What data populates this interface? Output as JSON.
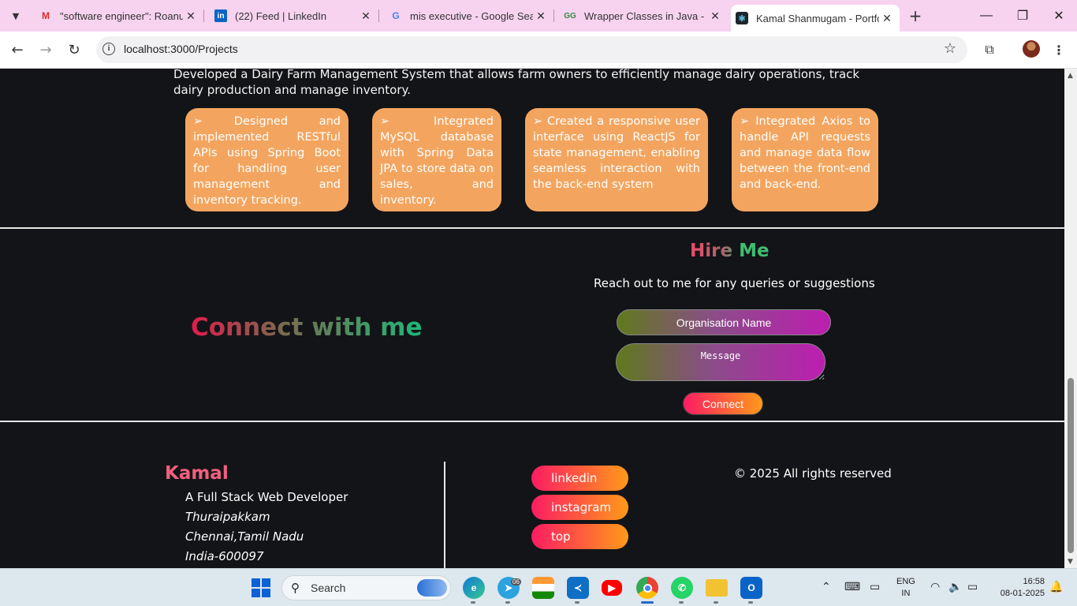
{
  "browser": {
    "tabs": [
      {
        "title": "\"software engineer\": Roanuz",
        "icon": "gmail-icon"
      },
      {
        "title": "(22) Feed | LinkedIn",
        "icon": "linkedin-icon"
      },
      {
        "title": "mis executive - Google Search",
        "icon": "google-icon"
      },
      {
        "title": "Wrapper Classes in Java - Ge",
        "icon": "geeksforgeeks-icon"
      },
      {
        "title": "Kamal Shanmugam - Portfolio",
        "icon": "react-icon",
        "active": true
      }
    ],
    "url": "localhost:3000/Projects"
  },
  "project": {
    "description": "Developed a Dairy Farm Management System that allows farm owners to efficiently manage dairy operations, track dairy production and manage inventory.",
    "cards": [
      "➢ Designed and implemented RESTful APIs using Spring Boot for handling user management and inventory tracking.",
      "➢ Integrated MySQL database with Spring Data JPA to store data on sales, and inventory.",
      "➢ Created a responsive user interface using ReactJS for state management, enabling seamless interaction with the back-end system",
      "➢ Integrated Axios to handle API requests and manage data flow between the front-end and back-end."
    ]
  },
  "contact": {
    "connect_heading": "Connect with me",
    "hire_heading": "Hire Me",
    "subtitle": "Reach out to me for any queries or suggestions",
    "org_placeholder": "Organisation Name",
    "message_placeholder": "Message",
    "submit_label": "Connect"
  },
  "footer": {
    "name": "Kamal",
    "role": "A Full Stack Web Developer",
    "address": [
      "Thuraipakkam",
      "Chennai,Tamil Nadu",
      "India-600097"
    ],
    "links": [
      "linkedin",
      "instagram",
      "top"
    ],
    "copyright": "© 2025 All rights reserved"
  },
  "taskbar": {
    "search_label": "Search",
    "telegram_badge": "06",
    "language": [
      "ENG",
      "IN"
    ],
    "time": "16:58",
    "date": "08-01-2025"
  },
  "colors": {
    "card_orange": "#f3a55f",
    "button_gradient_start": "#fc1c62",
    "button_gradient_end": "#ff9a1a",
    "page_background": "#131417",
    "tabbar_pink": "#f7d3f0"
  }
}
